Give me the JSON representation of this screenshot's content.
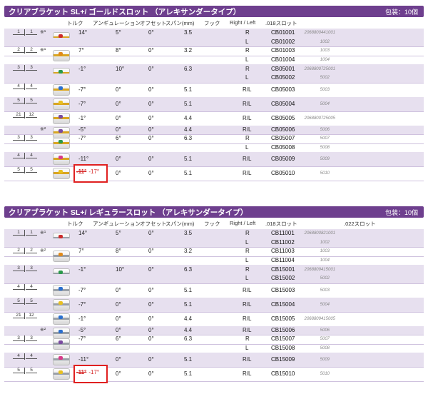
{
  "sections": [
    {
      "title": "クリアブラケット SL+/ ゴールドスロット （アレキサンダータイプ）",
      "pack": "包装：10個",
      "slot_color": "#d9a520",
      "headers": {
        "torque": "トルク",
        "angulation": "アンギュレーション",
        "offset": "オフセット",
        "span": "スパン(mm)",
        "hook": "フック",
        "rl": "Right / Left",
        "slot018": ".018スロット",
        "slot022": ""
      },
      "rows": [
        {
          "tooth_l": "1",
          "tooth_r": "1",
          "star": "※¹",
          "torque": "14°",
          "ang": "5°",
          "off": "0°",
          "span": "3.5",
          "rl": "R",
          "code": "CB01001",
          "jan": "2068800441001",
          "dot": "#cc2b2b"
        },
        {
          "tooth_l": "",
          "tooth_r": "",
          "star": "",
          "torque": "",
          "ang": "",
          "off": "",
          "span": "",
          "rl": "L",
          "code": "CB01002",
          "jan": "1002",
          "dot": ""
        },
        {
          "tooth_l": "2",
          "tooth_r": "2",
          "star": "※¹",
          "torque": "7°",
          "ang": "8°",
          "off": "0°",
          "span": "3.2",
          "rl": "R",
          "code": "CB01003",
          "jan": "1003",
          "dot": "#e08a1a"
        },
        {
          "tooth_l": "",
          "tooth_r": "",
          "star": "",
          "torque": "",
          "ang": "",
          "off": "",
          "span": "",
          "rl": "L",
          "code": "CB01004",
          "jan": "1004",
          "dot": ""
        },
        {
          "tooth_l": "3",
          "tooth_r": "3",
          "star": "",
          "torque": "-1°",
          "ang": "10°",
          "off": "0°",
          "span": "6.3",
          "rl": "R",
          "code": "CB05001",
          "jan": "2068800725001",
          "dot": "#2a9a4a"
        },
        {
          "tooth_l": "",
          "tooth_r": "",
          "star": "",
          "torque": "",
          "ang": "",
          "off": "",
          "span": "",
          "rl": "L",
          "code": "CB05002",
          "jan": "5002",
          "dot": ""
        },
        {
          "tooth_l": "4",
          "tooth_r": "4",
          "star": "",
          "torque": "-7°",
          "ang": "0°",
          "off": "0°",
          "span": "5.1",
          "rl": "R/L",
          "code": "CB05003",
          "jan": "5003",
          "dot": "#2a6fcf"
        },
        {
          "tooth_l": "5",
          "tooth_r": "5",
          "star": "",
          "torque": "-7°",
          "ang": "0°",
          "off": "0°",
          "span": "5.1",
          "rl": "R/L",
          "code": "CB05004",
          "jan": "5004",
          "dot": "#e8c020"
        },
        {
          "tooth_l": "21",
          "tooth_r": "12",
          "star": "",
          "torque": "-1°",
          "ang": "0°",
          "off": "0°",
          "span": "4.4",
          "rl": "R/L",
          "code": "CB05005",
          "jan": "2068800725005",
          "dot": "#7a4aa0"
        },
        {
          "tooth_l": "",
          "tooth_r": "",
          "star": "※²",
          "torque": "-5°",
          "ang": "0°",
          "off": "0°",
          "span": "4.4",
          "rl": "R/L",
          "code": "CB05006",
          "jan": "5006",
          "dot": "#7a4aa0"
        },
        {
          "tooth_l": "3",
          "tooth_r": "3",
          "star": "",
          "torque": "-7°",
          "ang": "6°",
          "off": "0°",
          "span": "6.3",
          "rl": "R",
          "code": "CB05007",
          "jan": "5007",
          "dot": "#2a9a4a"
        },
        {
          "tooth_l": "",
          "tooth_r": "",
          "star": "",
          "torque": "",
          "ang": "",
          "off": "",
          "span": "",
          "rl": "L",
          "code": "CB05008",
          "jan": "5008",
          "dot": ""
        },
        {
          "tooth_l": "4",
          "tooth_r": "4",
          "star": "",
          "torque": "-11°",
          "ang": "0°",
          "off": "0°",
          "span": "5.1",
          "rl": "R/L",
          "code": "CB05009",
          "jan": "5009",
          "dot": "#d83a8a"
        },
        {
          "tooth_l": "5",
          "tooth_r": "5",
          "star": "",
          "torque": "-11°",
          "torque_new": "-17°",
          "ang": "0°",
          "off": "0°",
          "span": "5.1",
          "rl": "R/L",
          "code": "CB05010",
          "jan": "5010",
          "dot": "#e8c020"
        }
      ]
    },
    {
      "title": "クリアブラケット SL+/ レギュラースロット （アレキサンダータイプ）",
      "pack": "包装：10個",
      "slot_color": "#9aa0a8",
      "headers": {
        "torque": "トルク",
        "angulation": "アンギュレーション",
        "offset": "オフセット",
        "span": "スパン(mm)",
        "hook": "フック",
        "rl": "Right / Left",
        "slot018": ".018スロット",
        "slot022": ".022スロット"
      },
      "rows": [
        {
          "tooth_l": "1",
          "tooth_r": "1",
          "star": "※¹",
          "torque": "14°",
          "ang": "5°",
          "off": "0°",
          "span": "3.5",
          "rl": "R",
          "code": "CB11001",
          "jan": "2068800821001",
          "dot": "#cc2b2b"
        },
        {
          "tooth_l": "",
          "tooth_r": "",
          "star": "",
          "torque": "",
          "ang": "",
          "off": "",
          "span": "",
          "rl": "L",
          "code": "CB11002",
          "jan": "1002",
          "dot": ""
        },
        {
          "tooth_l": "2",
          "tooth_r": "2",
          "star": "※²",
          "torque": "7°",
          "ang": "8°",
          "off": "0°",
          "span": "3.2",
          "rl": "R",
          "code": "CB11003",
          "jan": "1003",
          "dot": "#e08a1a"
        },
        {
          "tooth_l": "",
          "tooth_r": "",
          "star": "",
          "torque": "",
          "ang": "",
          "off": "",
          "span": "",
          "rl": "L",
          "code": "CB11004",
          "jan": "1004",
          "dot": ""
        },
        {
          "tooth_l": "3",
          "tooth_r": "3",
          "star": "",
          "torque": "-1°",
          "ang": "10°",
          "off": "0°",
          "span": "6.3",
          "rl": "R",
          "code": "CB15001",
          "jan": "2068809415001",
          "dot": "#2a9a4a"
        },
        {
          "tooth_l": "",
          "tooth_r": "",
          "star": "",
          "torque": "",
          "ang": "",
          "off": "",
          "span": "",
          "rl": "L",
          "code": "CB15002",
          "jan": "5002",
          "dot": ""
        },
        {
          "tooth_l": "4",
          "tooth_r": "4",
          "star": "",
          "torque": "-7°",
          "ang": "0°",
          "off": "0°",
          "span": "5.1",
          "rl": "R/L",
          "code": "CB15003",
          "jan": "5003",
          "dot": "#2a6fcf"
        },
        {
          "tooth_l": "5",
          "tooth_r": "5",
          "star": "",
          "torque": "-7°",
          "ang": "0°",
          "off": "0°",
          "span": "5.1",
          "rl": "R/L",
          "code": "CB15004",
          "jan": "5004",
          "dot": "#e8c020"
        },
        {
          "tooth_l": "21",
          "tooth_r": "12",
          "star": "",
          "torque": "-1°",
          "ang": "0°",
          "off": "0°",
          "span": "4.4",
          "rl": "R/L",
          "code": "CB15005",
          "jan": "2068809415005",
          "dot": "#2a6fcf"
        },
        {
          "tooth_l": "",
          "tooth_r": "",
          "star": "※²",
          "torque": "-5°",
          "ang": "0°",
          "off": "0°",
          "span": "4.4",
          "rl": "R/L",
          "code": "CB15006",
          "jan": "5006",
          "dot": "#2a6fcf"
        },
        {
          "tooth_l": "3",
          "tooth_r": "3",
          "star": "",
          "torque": "-7°",
          "ang": "6°",
          "off": "0°",
          "span": "6.3",
          "rl": "R",
          "code": "CB15007",
          "jan": "5007",
          "dot": "#7a4aa0"
        },
        {
          "tooth_l": "",
          "tooth_r": "",
          "star": "",
          "torque": "",
          "ang": "",
          "off": "",
          "span": "",
          "rl": "L",
          "code": "CB15008",
          "jan": "5008",
          "dot": ""
        },
        {
          "tooth_l": "4",
          "tooth_r": "4",
          "star": "",
          "torque": "-11°",
          "ang": "0°",
          "off": "0°",
          "span": "5.1",
          "rl": "R/L",
          "code": "CB15009",
          "jan": "5009",
          "dot": "#d83a8a"
        },
        {
          "tooth_l": "5",
          "tooth_r": "5",
          "star": "",
          "torque": "-11°",
          "torque_new": "-17°",
          "ang": "0°",
          "off": "0°",
          "span": "5.1",
          "rl": "R/L",
          "code": "CB15010",
          "jan": "5010",
          "dot": "#e8c020"
        }
      ]
    }
  ]
}
